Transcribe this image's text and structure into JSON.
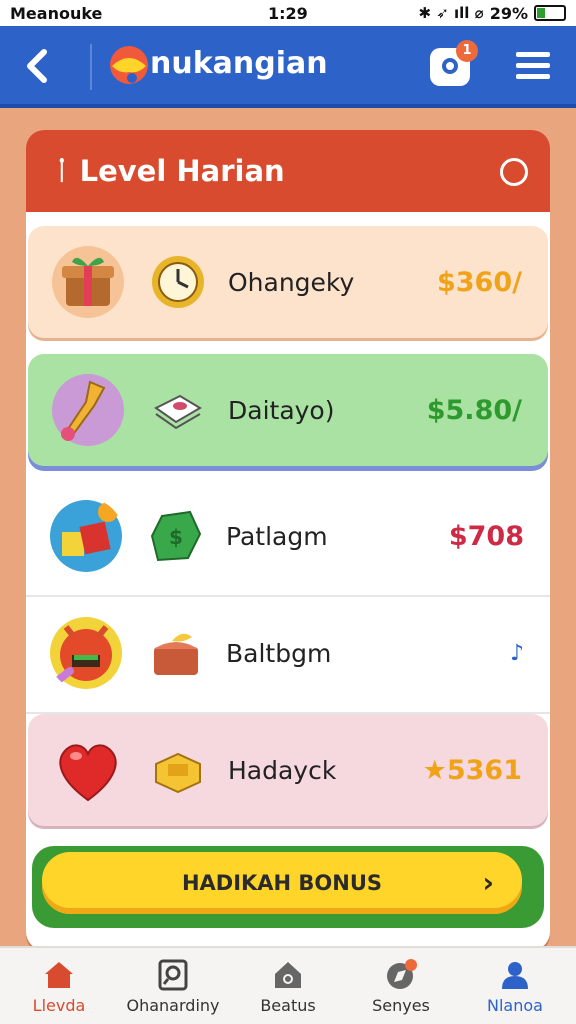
{
  "status": {
    "carrier": "Meanouke",
    "time": "1:29",
    "battery": "29%",
    "signal_glyphs": "✱ ➶ ıll ⌀"
  },
  "appbar": {
    "brand": "nukangian",
    "notification_count": "1"
  },
  "panel": {
    "title": "Level Harian",
    "rows": [
      {
        "name": "Ohangeky",
        "price": "$360/",
        "price_color": "#f0a218",
        "bg": "#fde3cc",
        "big_icon": "gift-box-icon",
        "small_icon": "clock-icon"
      },
      {
        "name": "Daitayo)",
        "price": "$5.80/",
        "price_color": "#2e9a2e",
        "bg": "#a9e2a3",
        "big_icon": "wand-icon",
        "small_icon": "papers-icon"
      },
      {
        "name": "Patlagm",
        "price": "$708",
        "price_color": "#cf2a45",
        "bg": "#ffffff",
        "big_icon": "toy-blocks-icon",
        "small_icon": "money-icon"
      },
      {
        "name": "Baltbgm",
        "price": "",
        "price_color": "#2d62c9",
        "bg": "#ffffff",
        "big_icon": "monster-icon",
        "small_icon": "treasure-box-icon"
      },
      {
        "name": "Hadayck",
        "price": "★5361",
        "price_color": "#f0a218",
        "bg": "#f6d9df",
        "big_icon": "heart-icon",
        "small_icon": "gold-box-icon"
      }
    ]
  },
  "bonus": {
    "label": "HADIKAH BONUS"
  },
  "nav": [
    {
      "label": "Llevda",
      "icon": "home-icon",
      "color": "#d84b2f"
    },
    {
      "label": "Ohanardiny",
      "icon": "search-card-icon",
      "color": "#333333"
    },
    {
      "label": "Beatus",
      "icon": "house-icon",
      "color": "#333333"
    },
    {
      "label": "Senyes",
      "icon": "compass-icon",
      "color": "#333333"
    },
    {
      "label": "Nlanoa",
      "icon": "profile-icon",
      "color": "#2d62c9"
    }
  ]
}
